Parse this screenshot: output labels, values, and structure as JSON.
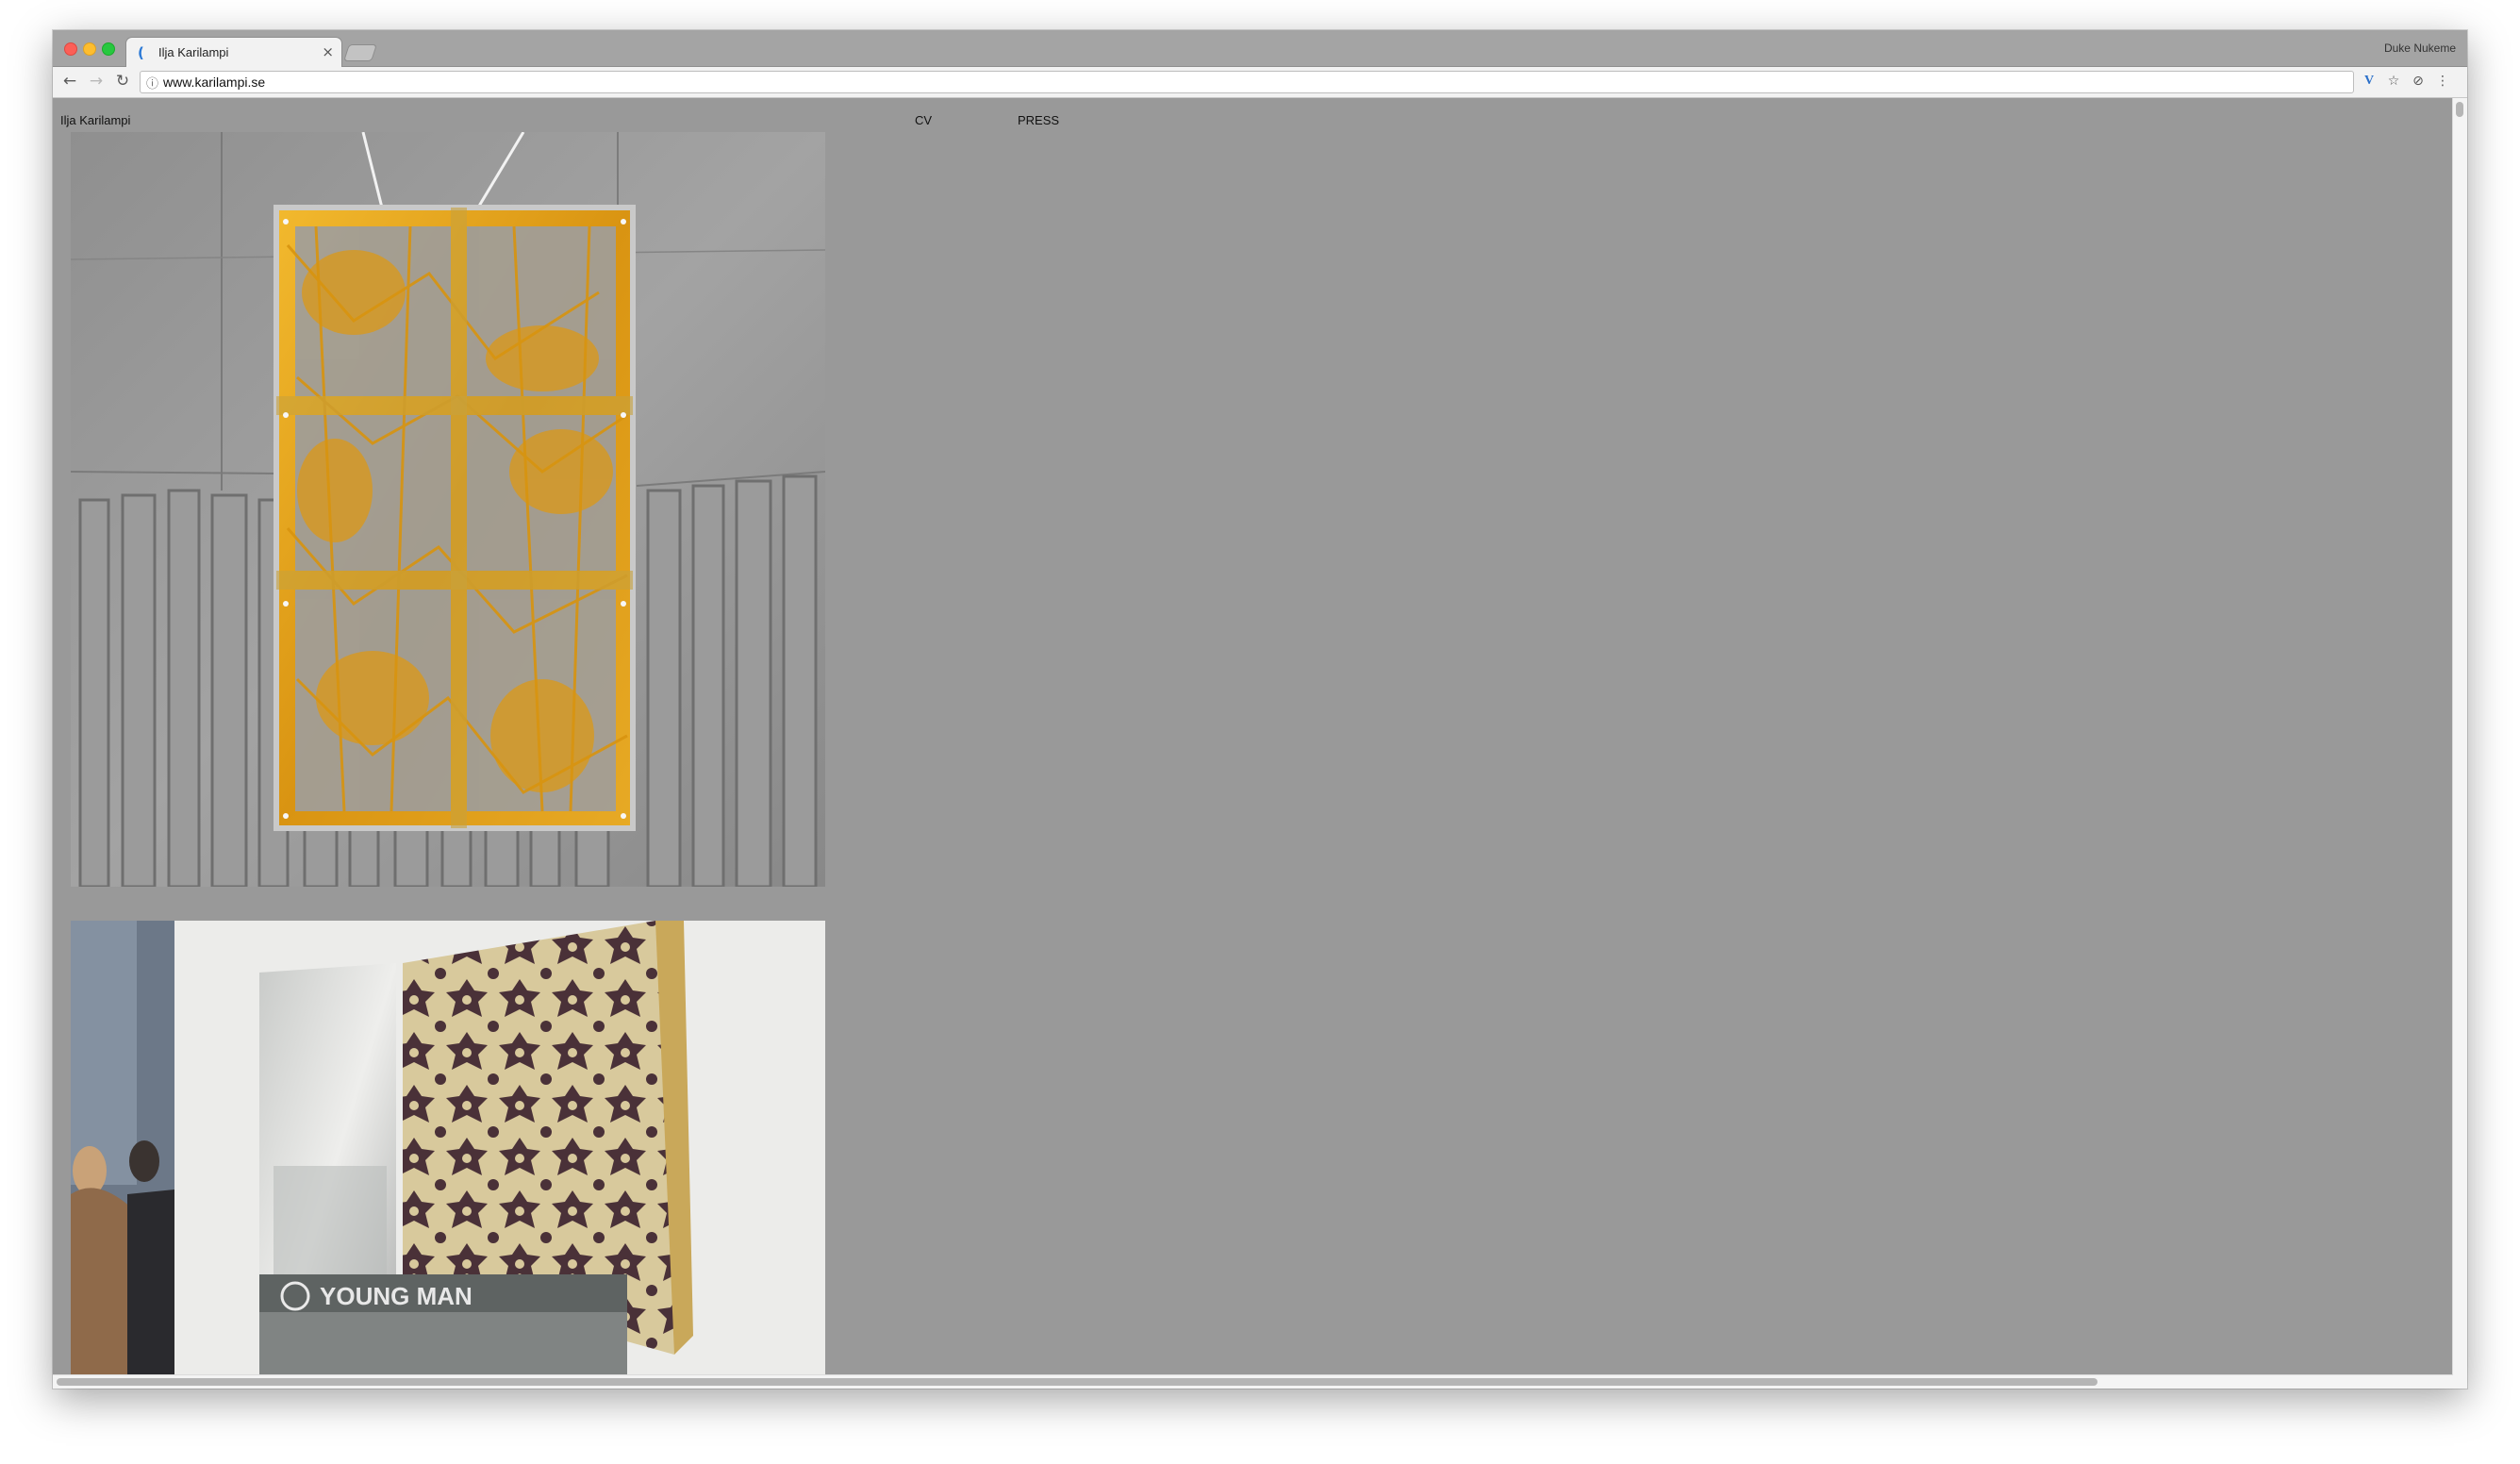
{
  "browser": {
    "tab_title": "Ilja Karilampi",
    "tab_close": "×",
    "profile_name": "Duke Nukeme",
    "url": "www.karilampi.se",
    "back_glyph": "←",
    "forward_glyph": "→",
    "reload_glyph": "↻",
    "info_glyph": "ⓘ",
    "extension_glyph": "V",
    "star_glyph": "☆",
    "extension2_glyph": "⊘",
    "menu_glyph": "⋮"
  },
  "site": {
    "title": "Ilja Karilampi",
    "nav": {
      "cv": "CV",
      "press": "PRESS"
    },
    "artworks": [
      {
        "icon": "yellow-grid-sculpture-photo"
      },
      {
        "icon": "young-man-fabric-installation-photo",
        "caption": "YOUNG MAN"
      }
    ]
  },
  "colors": {
    "page_background": "#999999",
    "gold": "#e3a11c",
    "fabric_dark": "#4a3138"
  }
}
